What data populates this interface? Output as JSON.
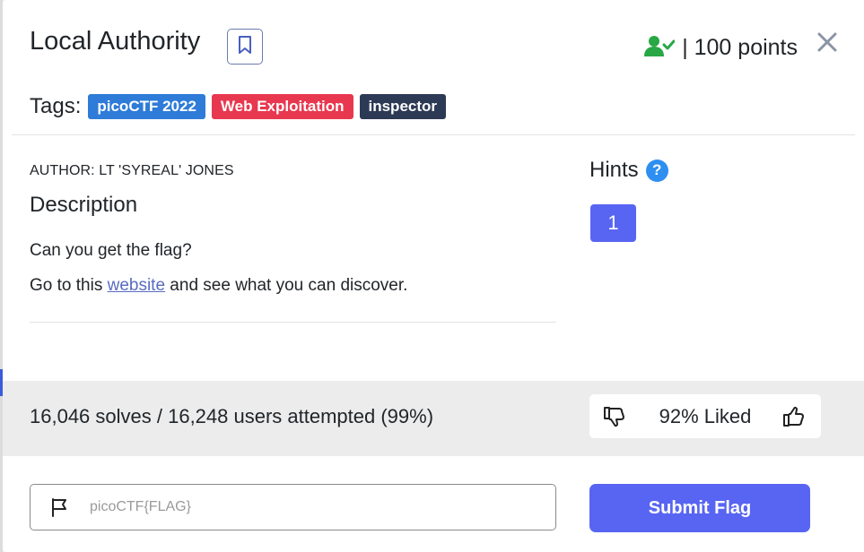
{
  "challenge": {
    "title": "Local Authority",
    "points_label": "| 100 points"
  },
  "tags": {
    "label": "Tags:",
    "items": [
      {
        "label": "picoCTF 2022",
        "color": "#2e7bd8"
      },
      {
        "label": "Web Exploitation",
        "color": "#e8384f"
      },
      {
        "label": "inspector",
        "color": "#2d3a55"
      }
    ]
  },
  "description": {
    "author": "AUTHOR: LT 'SYREAL' JONES",
    "heading": "Description",
    "line1": "Can you get the flag?",
    "line2_before": "Go to this ",
    "line2_link": "website",
    "line2_after": " and see what you can discover."
  },
  "hints": {
    "label": "Hints",
    "help_glyph": "?",
    "items": [
      "1"
    ]
  },
  "stats": {
    "solves_text": "16,046 solves / 16,248 users attempted (99%)",
    "liked_text": "92% Liked"
  },
  "flag_form": {
    "placeholder": "picoCTF{FLAG}",
    "value": "",
    "submit_label": "Submit Flag"
  },
  "colors": {
    "accent": "#5865f2",
    "solved_icon": "#28a745",
    "help_icon": "#2e8ff0",
    "link": "#5b6bc0"
  },
  "icons": {
    "bookmark": "bookmark-icon",
    "solved_user": "user-check-icon",
    "close": "close-icon",
    "help": "help-icon",
    "thumbs_down": "thumbs-down-icon",
    "thumbs_up": "thumbs-up-icon",
    "flag": "flag-icon"
  }
}
